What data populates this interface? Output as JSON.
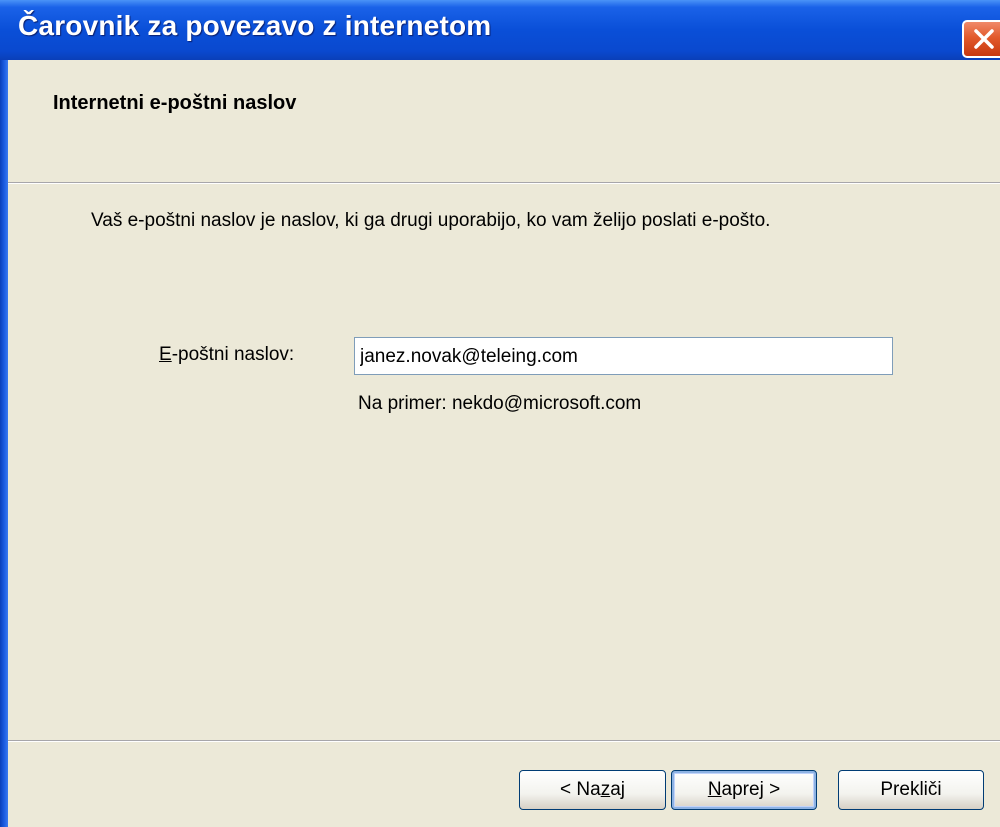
{
  "window": {
    "title": "Čarovnik za povezavo z internetom",
    "close_icon": "close-icon",
    "colors": {
      "titlebar": "#0a4fd8",
      "close": "#e25a2c",
      "background": "#ece9d8"
    }
  },
  "header": {
    "title": "Internetni e-poštni naslov"
  },
  "main": {
    "description": "Vaš e-poštni naslov je naslov, ki ga drugi uporabijo, ko vam želijo poslati e-pošto.",
    "email_label_accel": "E",
    "email_label_rest": "-poštni naslov:",
    "email_value": "janez.novak@teleing.com",
    "example": "Na primer: nekdo@microsoft.com"
  },
  "buttons": {
    "back_prefix": "< Na",
    "back_accel": "z",
    "back_suffix": "aj",
    "next_accel": "N",
    "next_suffix": "aprej >",
    "cancel": "Prekliči"
  }
}
